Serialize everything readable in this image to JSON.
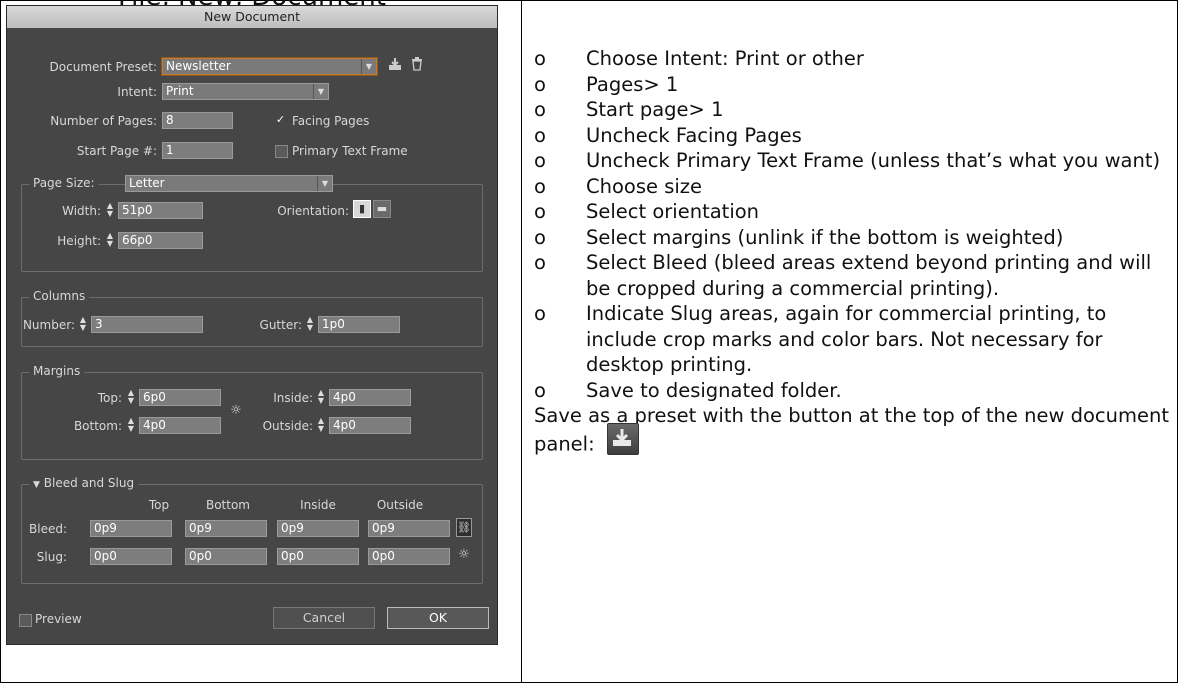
{
  "heading": "File, New, Document",
  "dialog": {
    "title": "New Document",
    "preset_label": "Document Preset:",
    "preset_value": "Newsletter",
    "intent_label": "Intent:",
    "intent_value": "Print",
    "pages_label": "Number of Pages:",
    "pages_value": "8",
    "facing_label": "Facing Pages",
    "start_label": "Start Page #:",
    "start_value": "1",
    "primary_label": "Primary Text Frame",
    "page_size_label": "Page Size:",
    "page_size_value": "Letter",
    "width_label": "Width:",
    "width_value": "51p0",
    "height_label": "Height:",
    "height_value": "66p0",
    "orientation_label": "Orientation:",
    "columns_title": "Columns",
    "number_label": "Number:",
    "number_value": "3",
    "gutter_label": "Gutter:",
    "gutter_value": "1p0",
    "margins_title": "Margins",
    "top_label": "Top:",
    "top_value": "6p0",
    "bottom_label": "Bottom:",
    "bottom_value": "4p0",
    "inside_label": "Inside:",
    "inside_value": "4p0",
    "outside_label": "Outside:",
    "outside_value": "4p0",
    "bleed_title": "Bleed and Slug",
    "col_headers": [
      "Top",
      "Bottom",
      "Inside",
      "Outside"
    ],
    "bleed_label": "Bleed:",
    "bleed_values": [
      "0p9",
      "0p9",
      "0p9",
      "0p9"
    ],
    "slug_label": "Slug:",
    "slug_values": [
      "0p0",
      "0p0",
      "0p0",
      "0p0"
    ],
    "preview_label": "Preview",
    "cancel_label": "Cancel",
    "ok_label": "OK"
  },
  "instructions": {
    "bullet": "o",
    "items": [
      "Choose Intent:  Print or other",
      "Pages> 1",
      "Start page> 1",
      "Uncheck Facing Pages",
      "Uncheck Primary Text Frame (unless that’s what you want)",
      "Choose size",
      "Select orientation",
      "Select margins (unlink if the bottom is weighted)",
      "Select Bleed (bleed areas extend beyond printing and will be cropped during a commercial printing).",
      "Indicate Slug areas, again for commercial printing, to include crop marks and color bars. Not necessary for desktop printing.",
      "Save to designated folder."
    ],
    "footer": "Save as a preset with the button at the top of the new document panel:"
  },
  "colors": {
    "dialog_bg": "#464646",
    "field_bg": "#7d7d7d",
    "preset_border": "#c87a2a"
  }
}
